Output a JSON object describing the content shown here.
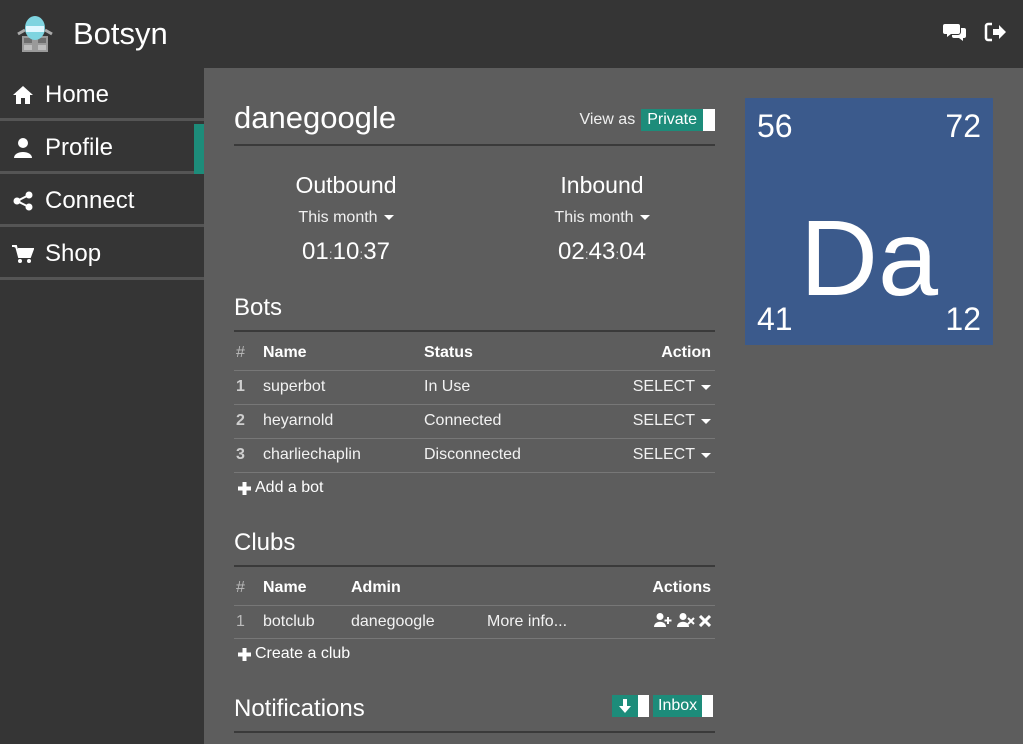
{
  "app": {
    "name": "Botsyn"
  },
  "topbar": {
    "icons": [
      "chat-icon",
      "sign-out-icon"
    ]
  },
  "sidebar": {
    "items": [
      {
        "label": "Home",
        "icon": "home-icon",
        "active": false
      },
      {
        "label": "Profile",
        "icon": "user-icon",
        "active": true
      },
      {
        "label": "Connect",
        "icon": "share-icon",
        "active": false
      },
      {
        "label": "Shop",
        "icon": "cart-icon",
        "active": false
      }
    ]
  },
  "profile": {
    "username": "danegoogle",
    "view_as_label": "View as",
    "view_as_value": "Private"
  },
  "stats": {
    "outbound": {
      "heading": "Outbound",
      "period": "This month",
      "h": "01",
      "m": "10",
      "s": "37"
    },
    "inbound": {
      "heading": "Inbound",
      "period": "This month",
      "h": "02",
      "m": "43",
      "s": "04"
    }
  },
  "bots": {
    "title": "Bots",
    "columns": [
      "#",
      "Name",
      "Status",
      "Action"
    ],
    "rows": [
      {
        "n": "1",
        "name": "superbot",
        "status": "In Use",
        "action": "SELECT"
      },
      {
        "n": "2",
        "name": "heyarnold",
        "status": "Connected",
        "action": "SELECT"
      },
      {
        "n": "3",
        "name": "charliechaplin",
        "status": "Disconnected",
        "action": "SELECT"
      }
    ],
    "add_label": "Add a bot"
  },
  "clubs": {
    "title": "Clubs",
    "columns": [
      "#",
      "Name",
      "Admin",
      "Actions"
    ],
    "rows": [
      {
        "n": "1",
        "name": "botclub",
        "admin": "danegoogle",
        "more": "More info..."
      }
    ],
    "create_label": "Create a club"
  },
  "notifications": {
    "title": "Notifications",
    "inbox_label": "Inbox"
  },
  "element_card": {
    "symbol": "Da",
    "top_left": "56",
    "top_right": "72",
    "bottom_left": "41",
    "bottom_right": "12",
    "color": "#3b5a8c"
  },
  "colors": {
    "accent": "#1d8c7a",
    "topbar": "#353535",
    "content": "#5d5d5d"
  }
}
